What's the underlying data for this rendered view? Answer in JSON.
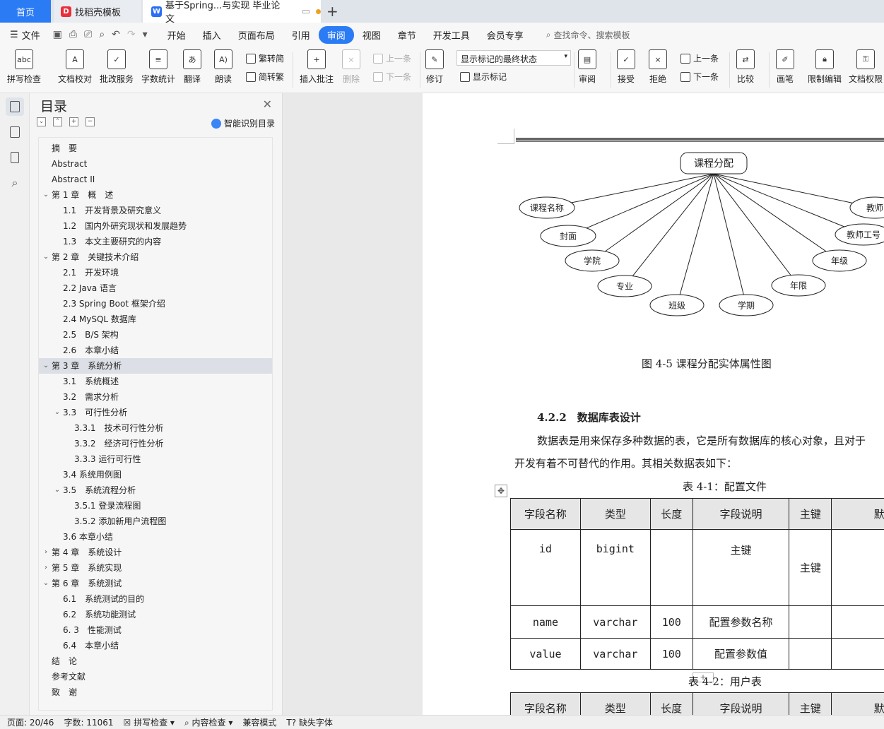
{
  "tabs": {
    "home": "首页",
    "doc1": "找稻壳模板",
    "doc2": "基于Spring...与实现 毕业论文"
  },
  "menu": {
    "file": "文件",
    "items": [
      "开始",
      "插入",
      "页面布局",
      "引用",
      "审阅",
      "视图",
      "章节",
      "开发工具",
      "会员专享"
    ],
    "active": "审阅",
    "search": "查找命令、搜索模板"
  },
  "ribbon": {
    "spell": "拼写检查",
    "proof": "文档校对",
    "batch": "批改服务",
    "wordcount": "字数统计",
    "translate": "翻译",
    "read": "朗读",
    "to_trad": "繁转简",
    "to_simp": "简转繁",
    "insert_comment": "插入批注",
    "delete": "删除",
    "prev_comment": "上一条",
    "next_comment": "下一条",
    "revise": "修订",
    "display_state": "显示标记的最终状态",
    "show_marks": "显示标记",
    "review": "审阅",
    "accept": "接受",
    "reject": "拒绝",
    "prev": "上一条",
    "next": "下一条",
    "compare": "比较",
    "pen": "画笔",
    "restrict": "限制编辑",
    "perm": "文档权限"
  },
  "toc": {
    "title": "目录",
    "smart": "智能识别目录",
    "items": [
      {
        "text": "摘　要",
        "level": 0,
        "caret": ""
      },
      {
        "text": "Abstract",
        "level": 0,
        "caret": ""
      },
      {
        "text": "Abstract II",
        "level": 0,
        "caret": ""
      },
      {
        "text": "第 1 章　概　述",
        "level": 0,
        "caret": "v"
      },
      {
        "text": "1.1　开发背景及研究意义",
        "level": 1,
        "caret": ""
      },
      {
        "text": "1.2　国内外研究现状和发展趋势",
        "level": 1,
        "caret": ""
      },
      {
        "text": "1.3　本文主要研究的内容",
        "level": 1,
        "caret": ""
      },
      {
        "text": "第 2 章　关键技术介绍",
        "level": 0,
        "caret": "v"
      },
      {
        "text": "2.1　开发环境",
        "level": 1,
        "caret": ""
      },
      {
        "text": "2.2 Java 语言",
        "level": 1,
        "caret": ""
      },
      {
        "text": "2.3 Spring Boot 框架介绍",
        "level": 1,
        "caret": ""
      },
      {
        "text": "2.4 MySQL 数据库",
        "level": 1,
        "caret": ""
      },
      {
        "text": "2.5　B/S 架构",
        "level": 1,
        "caret": ""
      },
      {
        "text": "2.6　本章小结",
        "level": 1,
        "caret": ""
      },
      {
        "text": "第 3 章　系统分析",
        "level": 0,
        "caret": "v",
        "selected": true
      },
      {
        "text": "3.1　系统概述",
        "level": 1,
        "caret": ""
      },
      {
        "text": "3.2　需求分析",
        "level": 1,
        "caret": ""
      },
      {
        "text": "3.3　可行性分析",
        "level": 1,
        "caret": "v"
      },
      {
        "text": "3.3.1　技术可行性分析",
        "level": 2,
        "caret": ""
      },
      {
        "text": "3.3.2　经济可行性分析",
        "level": 2,
        "caret": ""
      },
      {
        "text": "3.3.3 运行可行性",
        "level": 2,
        "caret": ""
      },
      {
        "text": "3.4 系统用例图",
        "level": 1,
        "caret": ""
      },
      {
        "text": "3.5　系统流程分析",
        "level": 1,
        "caret": "v"
      },
      {
        "text": "3.5.1 登录流程图",
        "level": 2,
        "caret": ""
      },
      {
        "text": "3.5.2 添加新用户流程图",
        "level": 2,
        "caret": ""
      },
      {
        "text": "3.6 本章小结",
        "level": 1,
        "caret": ""
      },
      {
        "text": "第 4 章　系统设计",
        "level": 0,
        "caret": ">"
      },
      {
        "text": "第 5 章　系统实现",
        "level": 0,
        "caret": ">"
      },
      {
        "text": "第 6 章　系统测试",
        "level": 0,
        "caret": "v"
      },
      {
        "text": "6.1　系统测试的目的",
        "level": 1,
        "caret": ""
      },
      {
        "text": "6.2　系统功能测试",
        "level": 1,
        "caret": ""
      },
      {
        "text": "6. 3　性能测试",
        "level": 1,
        "caret": ""
      },
      {
        "text": "6.4　本章小结",
        "level": 1,
        "caret": ""
      },
      {
        "text": "结　论",
        "level": 0,
        "caret": ""
      },
      {
        "text": "参考文献",
        "level": 0,
        "caret": ""
      },
      {
        "text": "致　谢",
        "level": 0,
        "caret": ""
      }
    ]
  },
  "doc": {
    "er_center": "课程分配",
    "er_attrs": [
      "课程名称",
      "封面",
      "学院",
      "专业",
      "班级",
      "学期",
      "年限",
      "年级",
      "教师工号",
      "教师"
    ],
    "figure_caption": "图 4-5 课程分配实体属性图",
    "heading": "4.2.2　数据库表设计",
    "para1": "数据表是用来保存多种数据的表，它是所有数据库的核心对象，且对于",
    "para2": "开发有着不可替代的作用。其相关数据表如下：",
    "table1_caption": "表 4-1：配置文件",
    "table_headers": [
      "字段名称",
      "类型",
      "长度",
      "字段说明",
      "主键",
      "默认值"
    ],
    "table1_rows": [
      [
        "id",
        "bigint",
        "",
        "主键",
        "主键",
        ""
      ],
      [
        "name",
        "varchar",
        "100",
        "配置参数名称",
        "",
        ""
      ],
      [
        "value",
        "varchar",
        "100",
        "配置参数值",
        "",
        ""
      ]
    ],
    "table2_caption": "表 4-2：用户表"
  },
  "status": {
    "page": "页面: 20/46",
    "words": "字数: 11061",
    "spell": "拼写检查",
    "content": "内容检查",
    "compat": "兼容模式",
    "missing_font": "缺失字体"
  }
}
